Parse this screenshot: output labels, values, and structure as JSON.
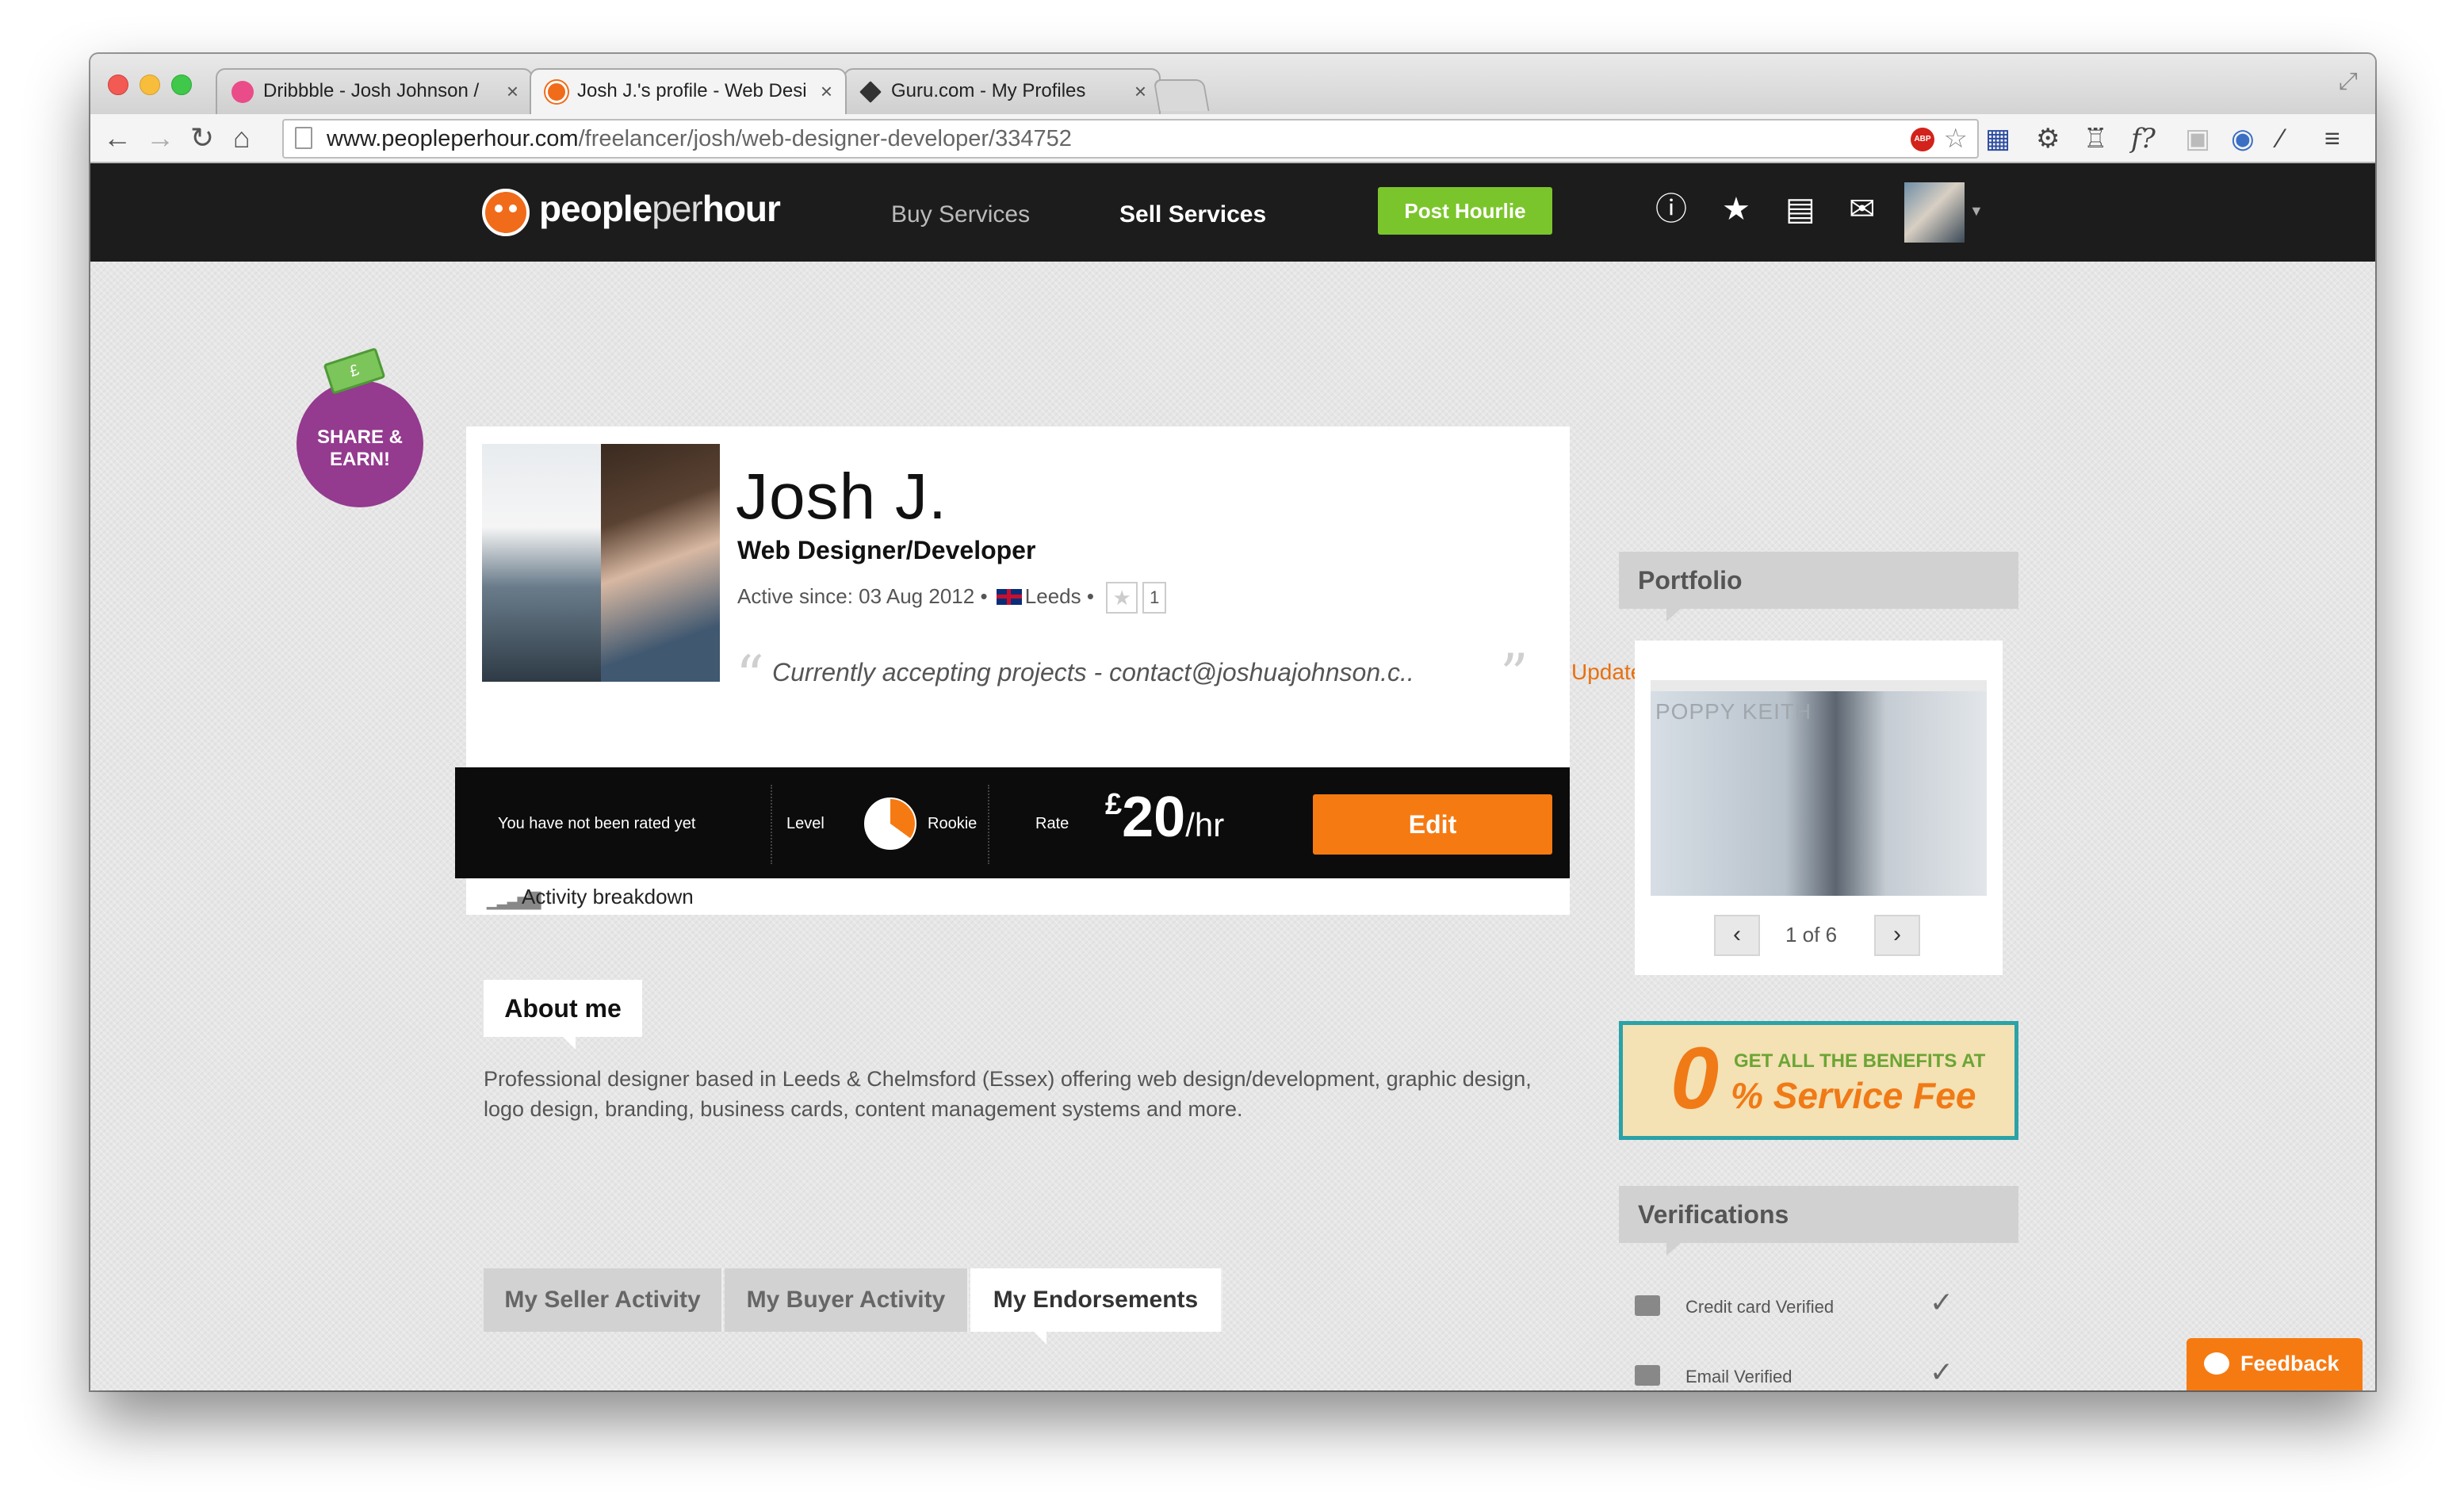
{
  "browser": {
    "tabs": [
      {
        "label": "Dribbble - Josh Johnson /",
        "active": false
      },
      {
        "label": "Josh J.'s profile - Web Desi",
        "active": true
      },
      {
        "label": "Guru.com - My Profiles",
        "active": false
      }
    ],
    "url_host": "www.peopleperhour.com",
    "url_path": "/freelancer/josh/web-designer-developer/334752",
    "abp_label": "ABP",
    "close_glyph": "×"
  },
  "header": {
    "logo_people": "people",
    "logo_per": "per",
    "logo_hour": "hour",
    "nav": [
      {
        "label": "Buy Services"
      },
      {
        "label": "Sell Services"
      }
    ],
    "post_button": "Post Hourlie"
  },
  "share": {
    "label": "SHARE & EARN!",
    "money_glyph": "£"
  },
  "profile": {
    "name": "Josh J.",
    "title": "Web Designer/Developer",
    "active_since": "Active since: 03 Aug 2012",
    "bullet": "•",
    "location": "Leeds",
    "fav_count": "1",
    "quote": "Currently accepting projects - contact@joshuajohnson.c...",
    "update_label": "Update"
  },
  "stats": {
    "rating_text": "You have not been rated yet",
    "level_label": "Level",
    "level_value": "Rookie",
    "level_progress": 0.35,
    "rate_label": "Rate",
    "rate_currency": "£",
    "rate_amount": "20",
    "rate_unit": "/hr",
    "edit_button": "Edit"
  },
  "activity": {
    "label": "Activity breakdown"
  },
  "about": {
    "heading": "About me",
    "text": "Professional designer based in Leeds & Chelmsford (Essex) offering web design/development, graphic design, logo design, branding, business cards, content management systems and more."
  },
  "profile_tabs": [
    {
      "label": "My Seller Activity",
      "active": false
    },
    {
      "label": "My Buyer Activity",
      "active": false
    },
    {
      "label": "My Endorsements",
      "active": true
    }
  ],
  "portfolio": {
    "heading": "Portfolio",
    "brand": "POPPY KEITH",
    "counter": "1 of 6",
    "prev": "‹",
    "next": "›"
  },
  "promo": {
    "zero": "0",
    "line1": "GET ALL THE BENEFITS AT",
    "line2": "% Service Fee"
  },
  "verifications": {
    "heading": "Verifications",
    "items": [
      {
        "label": "Credit card Verified"
      },
      {
        "label": "Email Verified"
      }
    ],
    "check": "✓"
  },
  "feedback_label": "Feedback",
  "colors": {
    "brand_orange": "#f67a12",
    "post_green": "#7bc52c",
    "share_purple": "#943a8f",
    "header_bg": "#1c1c1c"
  }
}
